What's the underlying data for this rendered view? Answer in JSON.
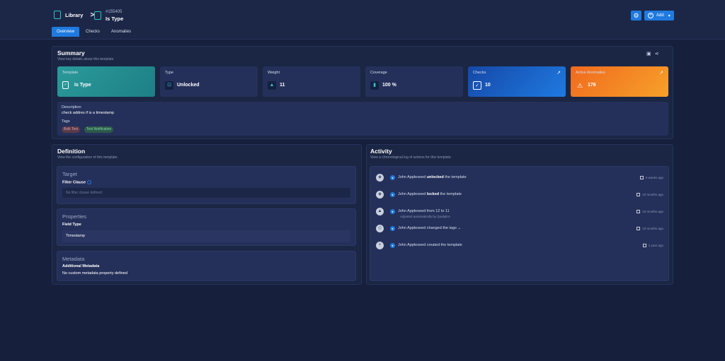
{
  "header": {
    "breadcrumb_library": "Library",
    "breadcrumb_sep": ">",
    "record_id": "#155405",
    "record_title": "Is Type",
    "add_label": "Add"
  },
  "tabs": [
    {
      "label": "Overview",
      "active": true
    },
    {
      "label": "Checks",
      "active": false
    },
    {
      "label": "Anomalies",
      "active": false
    }
  ],
  "summary": {
    "title": "Summary",
    "subtitle": "View key details about this template",
    "cards": {
      "template": {
        "label": "Template",
        "value": "Is Type"
      },
      "type": {
        "label": "Type",
        "value": "Unlocked"
      },
      "weight": {
        "label": "Weight",
        "value": "11"
      },
      "coverage": {
        "label": "Coverage",
        "value": "100 %"
      },
      "checks": {
        "label": "Checks",
        "value": "10"
      },
      "anomalies": {
        "label": "Active Anomalies",
        "value": "176"
      }
    },
    "description_label": "Description",
    "description": "check addres if is a timestamp",
    "tags_label": "Tags",
    "tags": [
      "Bulk Test",
      "Test Notification"
    ]
  },
  "definition": {
    "title": "Definition",
    "subtitle": "View the configuration of this template.",
    "target": {
      "title": "Target",
      "filter_label": "Filter Clause",
      "filter_placeholder": "No filter clause defined"
    },
    "properties": {
      "title": "Properties",
      "field_type_label": "Field Type",
      "field_type_value": "Timestamp"
    },
    "metadata": {
      "title": "Metadata",
      "label": "Additional Metadata",
      "value": "No custom metadata property defined"
    }
  },
  "activity": {
    "title": "Activity",
    "subtitle": "View a chronological log of actions for this template.",
    "items": [
      {
        "user": "John Appleseed",
        "action": "unlocked",
        "rest": "the template",
        "time": "2 weeks ago",
        "icon": "shield-icon"
      },
      {
        "user": "John Appleseed",
        "action": "locked",
        "rest": "the template",
        "time": "10 months ago",
        "icon": "shield-icon"
      },
      {
        "user": "John Appleseed",
        "action": "",
        "rest": "from 12 to 11",
        "sub": "Adjusted automatically by Qualytics",
        "time": "10 months ago",
        "icon": "weight-icon"
      },
      {
        "user": "John Appleseed",
        "action": "",
        "rest": "changed the tags",
        "time": "10 months ago",
        "icon": "tag-icon"
      },
      {
        "user": "John Appleseed",
        "action": "",
        "rest": "created the template",
        "time": "1 year ago",
        "icon": "plus-icon"
      }
    ]
  }
}
